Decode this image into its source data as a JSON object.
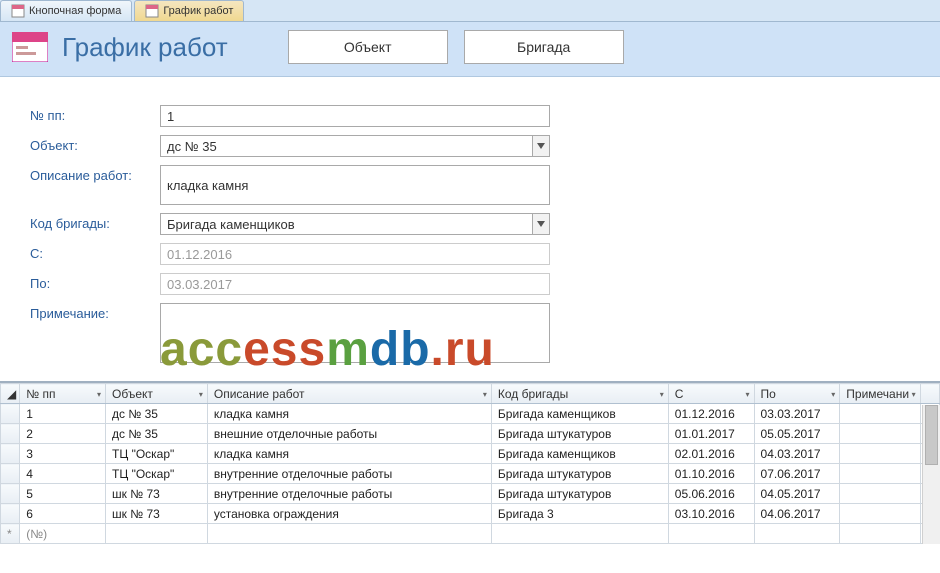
{
  "tabs": {
    "first": "Кнопочная форма",
    "second": "График работ"
  },
  "header": {
    "title": "График работ",
    "btn_object": "Объект",
    "btn_brigade": "Бригада"
  },
  "form": {
    "labels": {
      "num": "№ пп:",
      "object": "Объект:",
      "desc": "Описание работ:",
      "brigade": "Код бригады:",
      "from": "С:",
      "to": "По:",
      "note": "Примечание:"
    },
    "values": {
      "num": "1",
      "object": "дс № 35",
      "desc": "кладка камня",
      "brigade": "Бригада каменщиков",
      "from": "01.12.2016",
      "to": "03.03.2017",
      "note": ""
    }
  },
  "datasheet": {
    "cols": {
      "num": "№ пп",
      "object": "Объект",
      "desc": "Описание работ",
      "brigade": "Код бригады",
      "from": "С",
      "to": "По",
      "note": "Примечани"
    },
    "rows": [
      {
        "num": "1",
        "object": "дс № 35",
        "desc": "кладка камня",
        "brigade": "Бригада каменщиков",
        "from": "01.12.2016",
        "to": "03.03.2017",
        "note": ""
      },
      {
        "num": "2",
        "object": "дс № 35",
        "desc": "внешние отделочные работы",
        "brigade": "Бригада штукатуров",
        "from": "01.01.2017",
        "to": "05.05.2017",
        "note": ""
      },
      {
        "num": "3",
        "object": "ТЦ \"Оскар\"",
        "desc": "кладка камня",
        "brigade": "Бригада каменщиков",
        "from": "02.01.2016",
        "to": "04.03.2017",
        "note": ""
      },
      {
        "num": "4",
        "object": "ТЦ \"Оскар\"",
        "desc": "внутренние отделочные работы",
        "brigade": "Бригада штукатуров",
        "from": "01.10.2016",
        "to": "07.06.2017",
        "note": ""
      },
      {
        "num": "5",
        "object": "шк № 73",
        "desc": "внутренние отделочные работы",
        "brigade": "Бригада штукатуров",
        "from": "05.06.2016",
        "to": "04.05.2017",
        "note": ""
      },
      {
        "num": "6",
        "object": "шк № 73",
        "desc": "установка ограждения",
        "brigade": "Бригада 3",
        "from": "03.10.2016",
        "to": "04.06.2017",
        "note": ""
      }
    ],
    "newrow_label": "(№)",
    "newrow_marker": "*"
  }
}
